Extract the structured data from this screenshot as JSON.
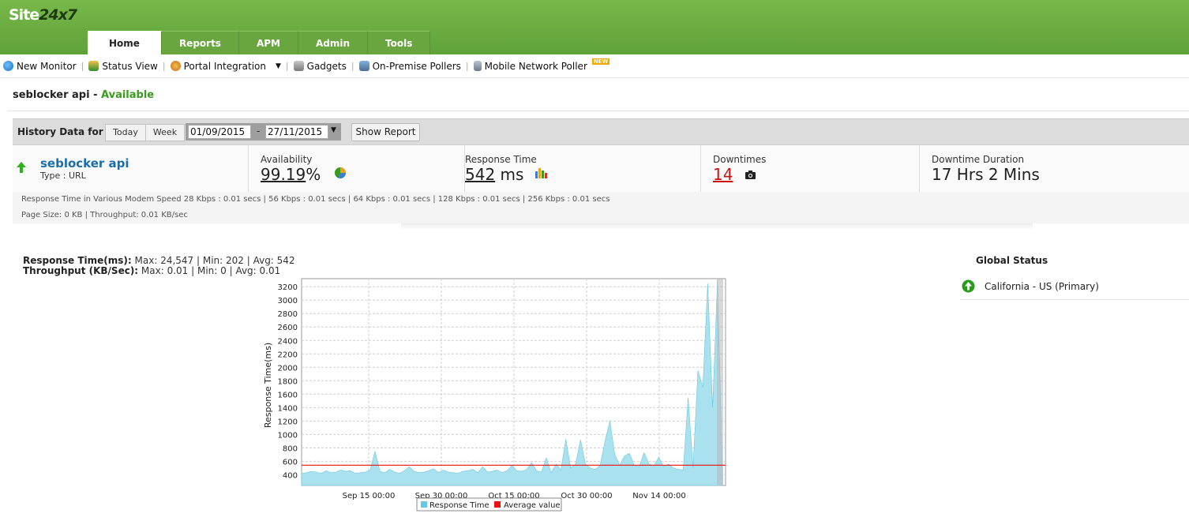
{
  "logo": {
    "text_a": "Site",
    "text_b": "24x7"
  },
  "tabs": [
    {
      "label": "Home",
      "active": true
    },
    {
      "label": "Reports",
      "active": false
    },
    {
      "label": "APM",
      "active": false
    },
    {
      "label": "Admin",
      "active": false
    },
    {
      "label": "Tools",
      "active": false
    }
  ],
  "toolbar": {
    "new_monitor": "New Monitor",
    "status_view": "Status View",
    "portal_integration": "Portal Integration",
    "gadgets": "Gadgets",
    "on_premise": "On-Premise Pollers",
    "mobile_poller": "Mobile Network Poller",
    "new_badge": "NEW"
  },
  "monitor": {
    "name": "seblocker api",
    "status": "Available"
  },
  "history": {
    "label": "History Data for :",
    "today": "Today",
    "week": "Week",
    "from": "01/09/2015",
    "to": "27/11/2015",
    "range_sep": "-",
    "show_report": "Show Report"
  },
  "summary": {
    "name": "seblocker api",
    "type": "Type : URL",
    "availability_label": "Availability",
    "availability_value": "99.19",
    "availability_unit": "%",
    "response_label": "Response Time",
    "response_value": "542",
    "response_unit": "ms",
    "downtimes_label": "Downtimes",
    "downtimes_value": "14",
    "duration_label": "Downtime Duration",
    "duration_value": "17 Hrs 2 Mins"
  },
  "info": {
    "modem": "Response Time in Various Modem Speed 28 Kbps : 0.01 secs | 56 Kbps : 0.01 secs | 64 Kbps : 0.01 secs | 128 Kbps : 0.01 secs | 256 Kbps : 0.01 secs",
    "page": "Page Size: 0 KB | Throughput: 0.01 KB/sec"
  },
  "chart_meta": {
    "rt_label": "Response Time(ms):",
    "rt_stats": " Max: 24,547 | Min: 202 | Avg: 542",
    "tp_label": "Throughput (KB/Sec):",
    "tp_stats": " Max: 0.01 | Min: 0 | Avg: 0.01"
  },
  "global_status": {
    "title": "Global Status",
    "location": "California - US (Primary)"
  },
  "colors": {
    "area": "#a9e1ef",
    "area_stroke": "#69c8df",
    "avg": "#ee1111",
    "green": "#3a9c1c",
    "red": "#cc1111"
  },
  "chart_data": {
    "type": "area",
    "ylabel": "Response Time(ms)",
    "xlabel": "",
    "ylim": [
      240,
      3320
    ],
    "yticks": [
      400,
      600,
      800,
      1000,
      1200,
      1400,
      1600,
      1800,
      2000,
      2200,
      2400,
      2600,
      2800,
      3000,
      3200
    ],
    "x_ticks": [
      "Sep 15 00:00",
      "Sep 30 00:00",
      "Oct 15 00:00",
      "Oct 30 00:00",
      "Nov 14 00:00"
    ],
    "grid": true,
    "legend_position": "bottom",
    "series": [
      {
        "name": "Response Time",
        "type": "area",
        "values": [
          420,
          430,
          450,
          440,
          420,
          460,
          430,
          440,
          470,
          450,
          460,
          420,
          430,
          440,
          470,
          750,
          450,
          430,
          480,
          440,
          420,
          460,
          520,
          450,
          430,
          440,
          460,
          490,
          430,
          470,
          440,
          430,
          420,
          450,
          460,
          480,
          430,
          520,
          440,
          450,
          470,
          430,
          460,
          540,
          460,
          450,
          480,
          580,
          460,
          440,
          650,
          430,
          560,
          470,
          930,
          500,
          560,
          920,
          560,
          500,
          480,
          540,
          900,
          1200,
          700,
          540,
          680,
          720,
          540,
          520,
          730,
          560,
          540,
          660,
          520,
          560,
          500,
          480,
          470,
          1550,
          500,
          1950,
          1700,
          3250,
          1400,
          3300,
          420
        ]
      },
      {
        "name": "Average value",
        "type": "line",
        "values": [
          542
        ]
      }
    ]
  }
}
